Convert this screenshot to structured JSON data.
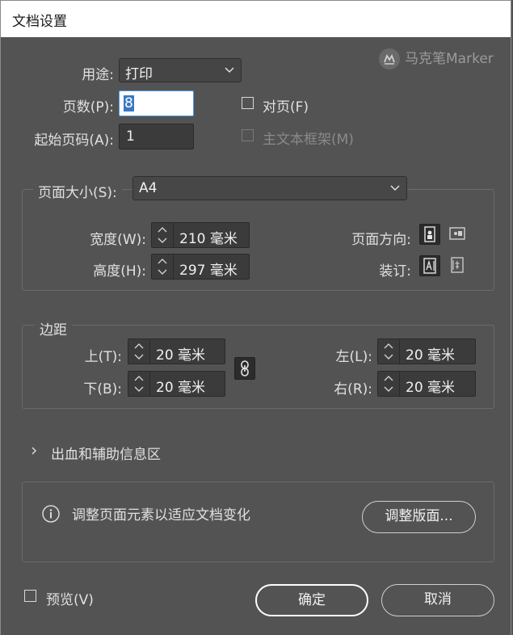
{
  "window": {
    "title": "文档设置"
  },
  "watermark": {
    "text": "马克笔Marker",
    "icon": "marker-logo-icon"
  },
  "intent": {
    "label": "用途:",
    "value": "打印"
  },
  "pages": {
    "label": "页数(P):",
    "value": "8"
  },
  "facing_pages": {
    "label": "对页(F)",
    "checked": false
  },
  "start_page": {
    "label": "起始页码(A):",
    "value": "1"
  },
  "primary_text_frame": {
    "label": "主文本框架(M)",
    "checked": false,
    "enabled": false
  },
  "page_size": {
    "label": "页面大小(S):",
    "value": "A4",
    "width_label": "宽度(W):",
    "width_value": "210 毫米",
    "height_label": "高度(H):",
    "height_value": "297 毫米",
    "orientation_label": "页面方向:",
    "binding_label": "装订:"
  },
  "margins": {
    "legend": "边距",
    "top_label": "上(T):",
    "top_value": "20 毫米",
    "bottom_label": "下(B):",
    "bottom_value": "20 毫米",
    "left_label": "左(L):",
    "left_value": "20 毫米",
    "right_label": "右(R):",
    "right_value": "20 毫米"
  },
  "bleed_slug": {
    "label": "出血和辅助信息区",
    "expanded": false
  },
  "adjust": {
    "info_text": "调整页面元素以适应文档变化",
    "button_label": "调整版面..."
  },
  "preview": {
    "label": "预览(V)",
    "checked": false
  },
  "buttons": {
    "ok": "确定",
    "cancel": "取消"
  },
  "colors": {
    "background": "#535353",
    "titlebar": "#ffffff",
    "field": "#3b3b3b",
    "selection": "#3a78c4"
  }
}
